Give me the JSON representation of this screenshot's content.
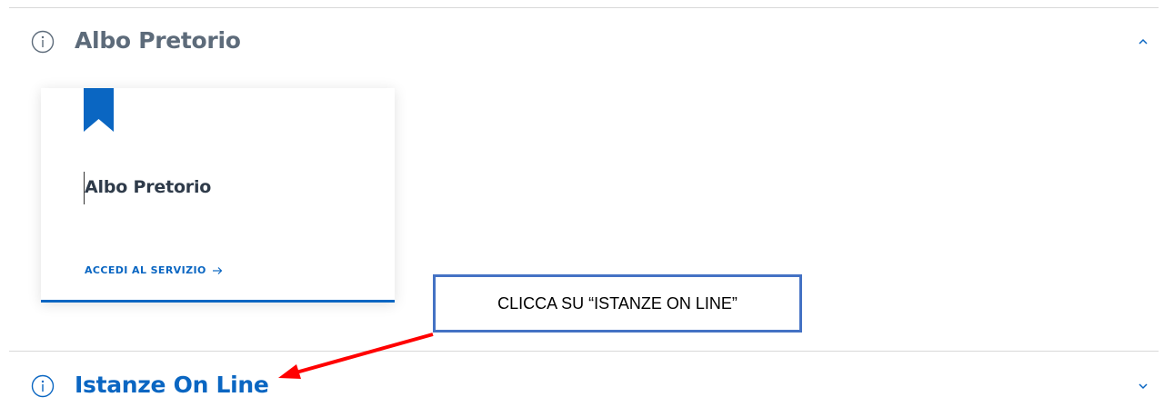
{
  "accordion": {
    "sections": [
      {
        "title": "Albo Pretorio",
        "expanded": true,
        "icon": "info-circle-icon",
        "toggle_icon": "chevron-up-icon"
      },
      {
        "title": "Istanze On Line",
        "expanded": false,
        "icon": "info-circle-icon",
        "toggle_icon": "chevron-down-icon"
      }
    ],
    "card": {
      "icon": "bookmark-icon",
      "title": "Albo Pretorio",
      "link_label": "ACCEDI AL SERVIZIO",
      "link_icon": "arrow-right-icon"
    }
  },
  "annotation": {
    "callout_text": "CLICCA SU “ISTANZE ON LINE”",
    "arrow": "red-arrow-icon"
  },
  "colors": {
    "accent": "#0a66c2",
    "heading_gray": "#5d6b7a",
    "callout_border": "#4472c4",
    "annotation_arrow": "#ff0000"
  }
}
